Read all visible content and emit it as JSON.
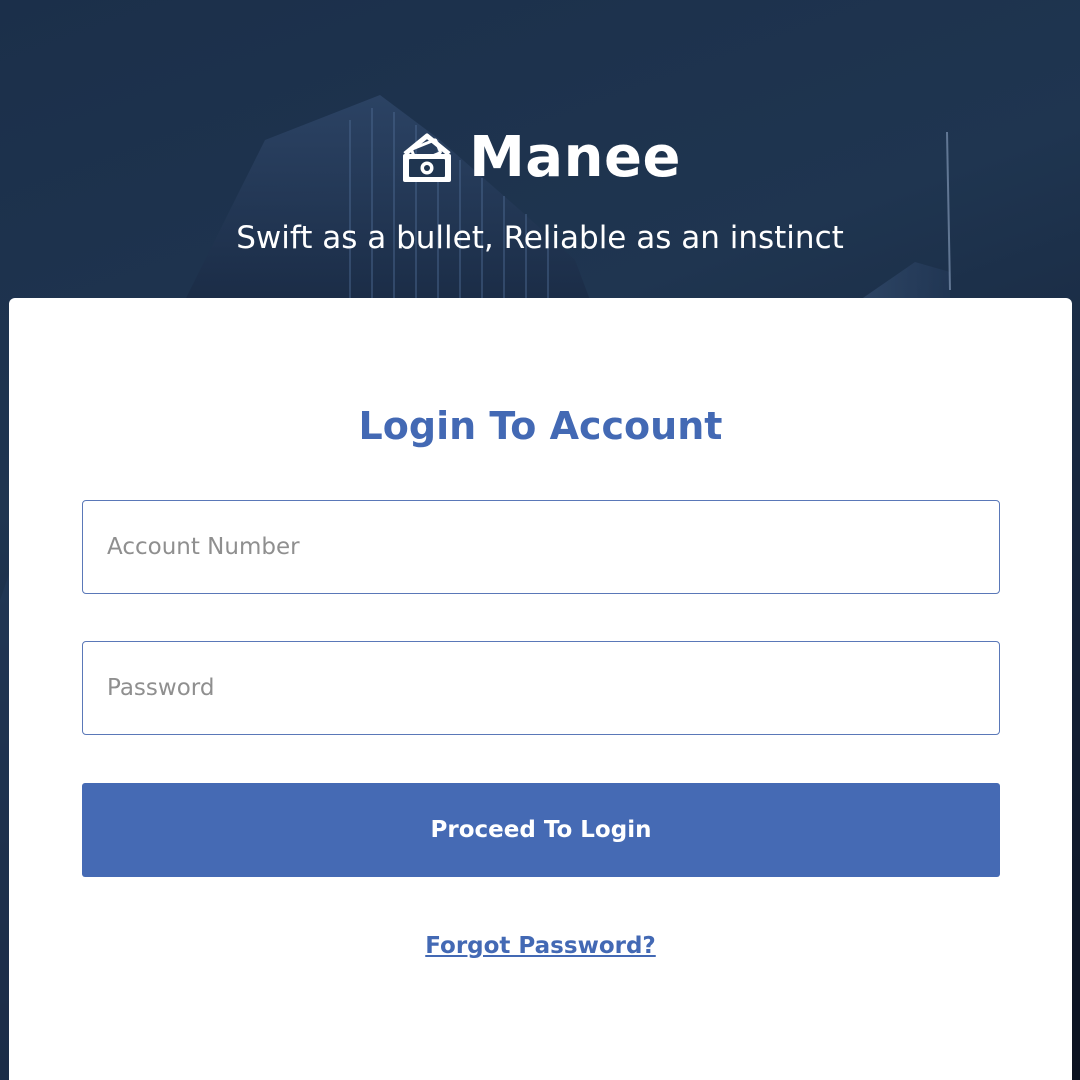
{
  "brand": {
    "name": "Manee",
    "tagline": "Swift as a bullet, Reliable as an instinct",
    "logo_icon": "money-house-icon"
  },
  "login": {
    "title": "Login To Account",
    "account_placeholder": "Account Number",
    "account_value": "",
    "password_placeholder": "Password",
    "password_value": "",
    "submit_label": "Proceed To Login",
    "forgot_label": "Forgot Password?"
  },
  "colors": {
    "accent": "#456ab4",
    "background": "#1d3350",
    "card": "#ffffff"
  }
}
